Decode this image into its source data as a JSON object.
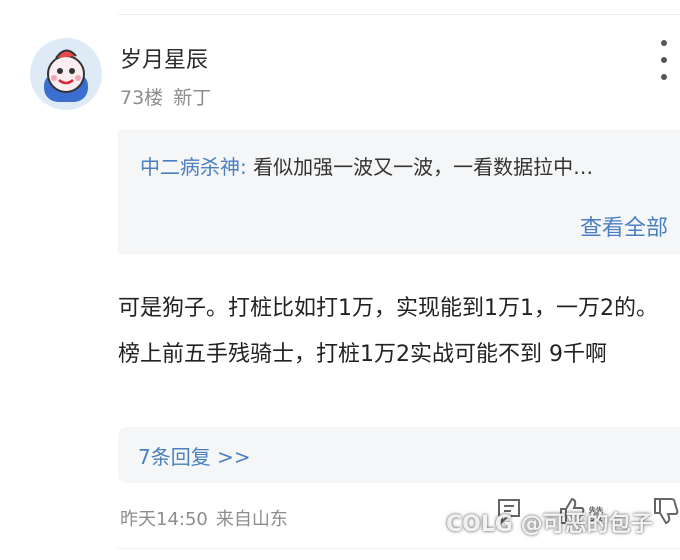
{
  "post": {
    "username": "岁月星辰",
    "floor": "73楼",
    "user_tag": "新丁"
  },
  "quote": {
    "author": "中二病杀神:",
    "text": " 看似加强一波又一波，一看数据拉中…",
    "view_all": "查看全部"
  },
  "comment": {
    "text": "可是狗子。打桩比如打1万，实现能到1万1，一万2的。榜上前五手残骑士，打桩1万2实战可能不到 9千啊"
  },
  "replies": {
    "link_text": "7条回复 >>"
  },
  "footer": {
    "time": "昨天14:50",
    "location": "来自山东"
  },
  "actions": {
    "like_label": "赞",
    "icons": [
      "comment-icon",
      "like-icon",
      "dislike-icon"
    ]
  },
  "watermark": "COLG @可恶的包子",
  "colors": {
    "accent_blue": "#4a7fc1",
    "meta_gray": "#8e8e8e",
    "panel_bg": "#f5f6f7"
  }
}
